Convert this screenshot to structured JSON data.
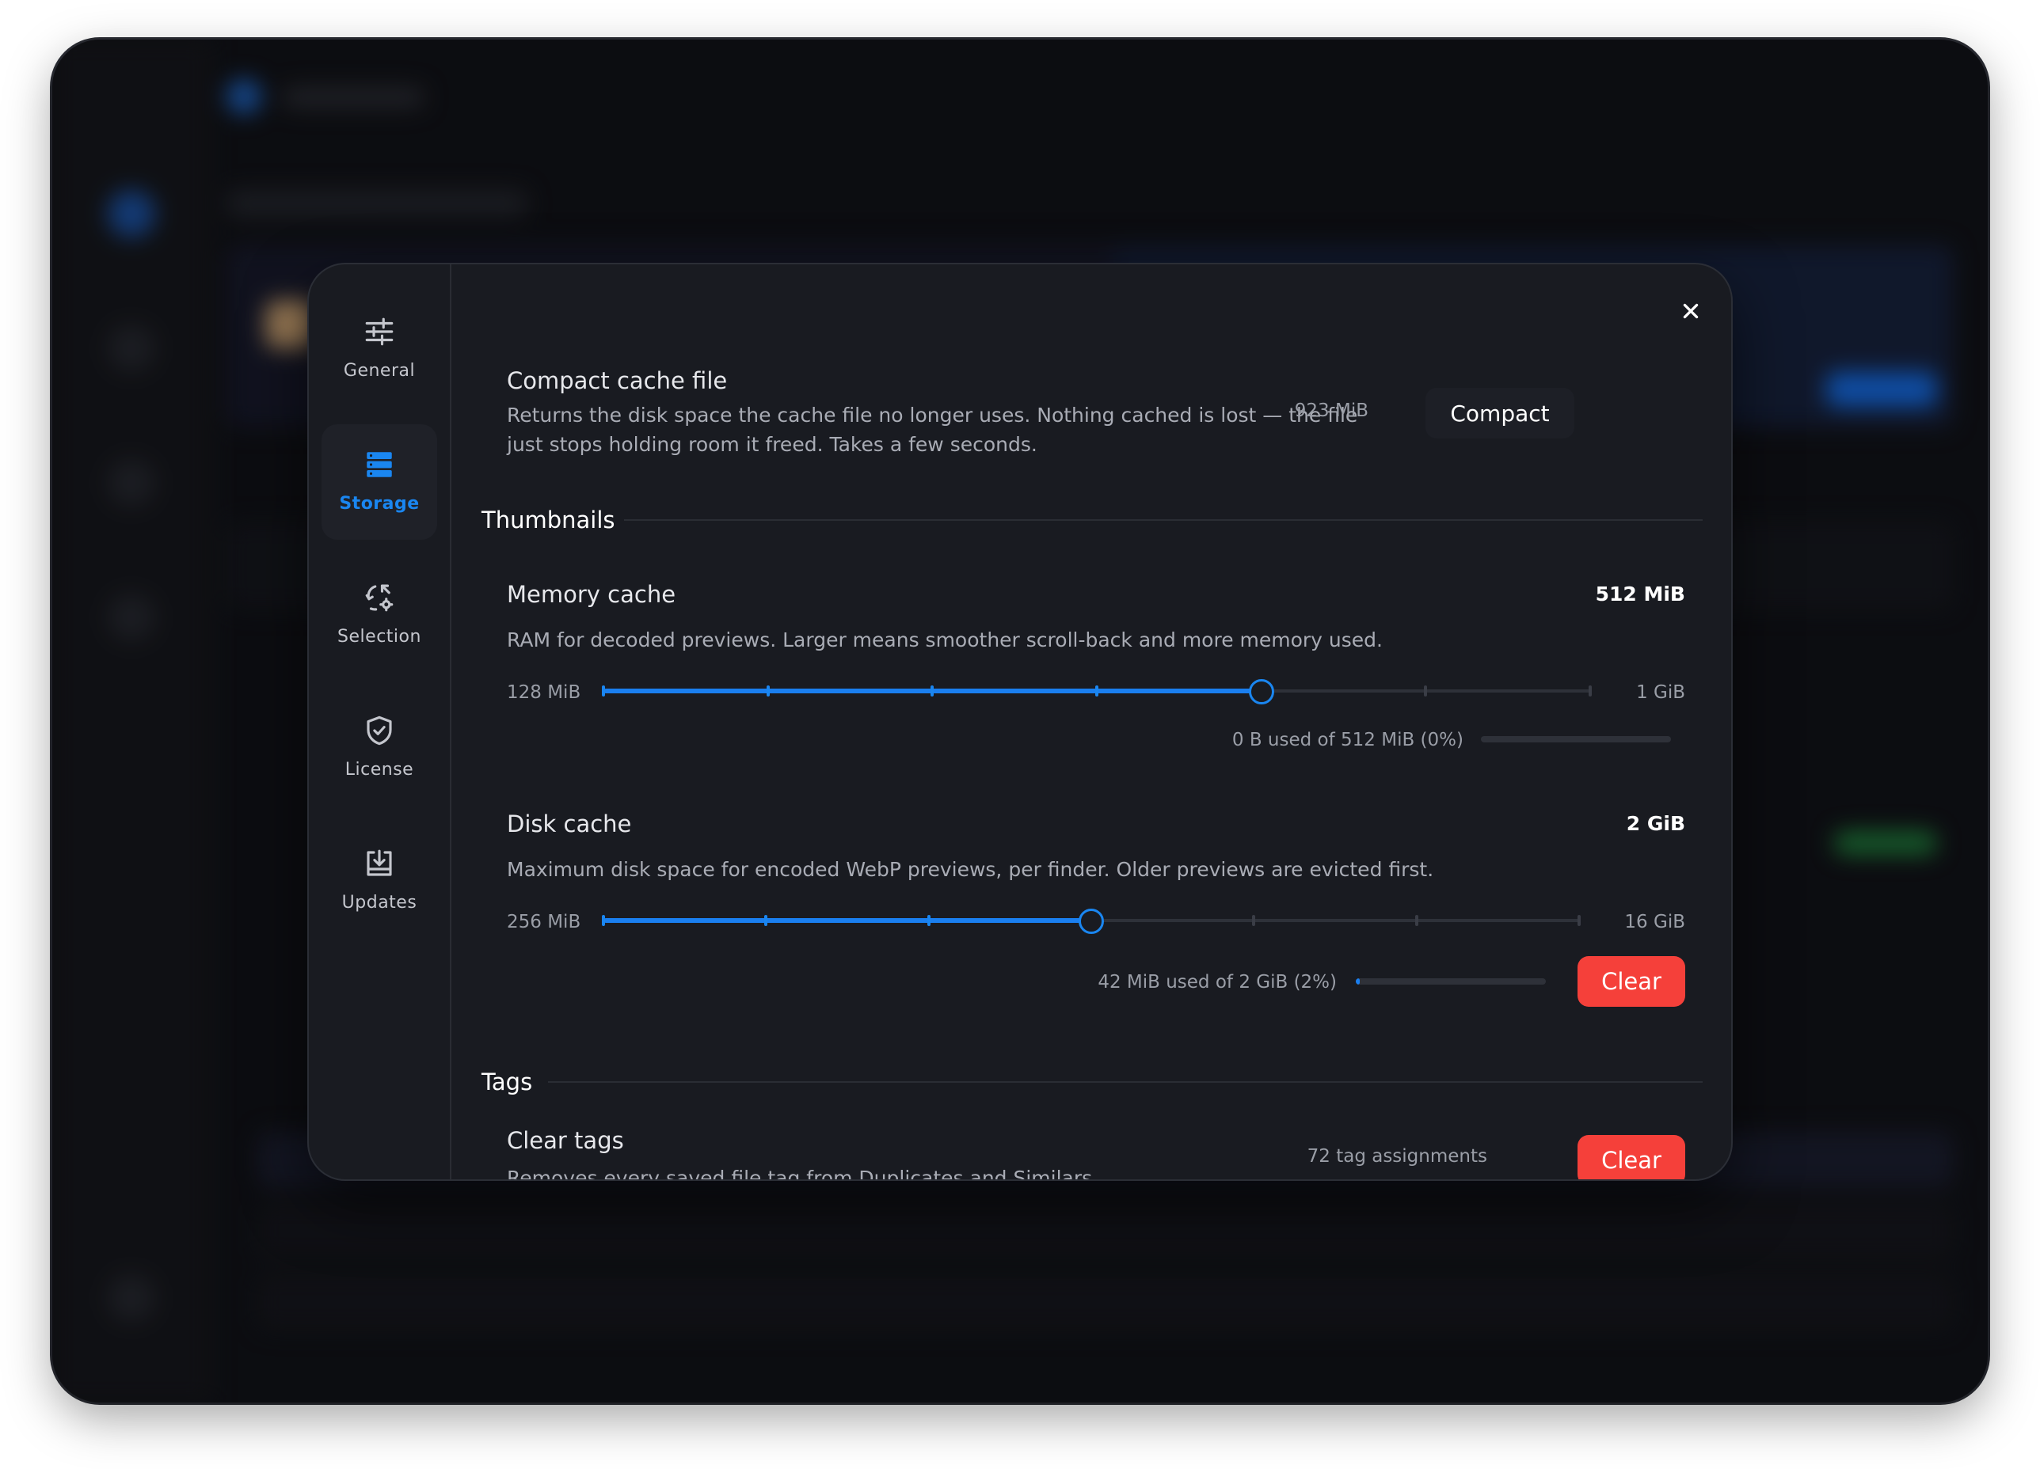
{
  "nav": {
    "items": [
      {
        "id": "general",
        "label": "General",
        "icon": "sliders-icon"
      },
      {
        "id": "storage",
        "label": "Storage",
        "icon": "storage-icon",
        "active": true
      },
      {
        "id": "selection",
        "label": "Selection",
        "icon": "selection-icon"
      },
      {
        "id": "license",
        "label": "License",
        "icon": "shield-icon"
      },
      {
        "id": "updates",
        "label": "Updates",
        "icon": "download-box-icon"
      }
    ]
  },
  "compact": {
    "title": "Compact cache file",
    "description_line1": "Returns the disk space the cache file no longer uses. Nothing cached is lost — the file",
    "description_line2": "just stops holding room it freed. Takes a few seconds.",
    "size": "923 MiB",
    "button": "Compact"
  },
  "thumbnails": {
    "section_title": "Thumbnails",
    "memory": {
      "title": "Memory cache",
      "value": "512 MiB",
      "description": "RAM for decoded previews. Larger means smoother scroll-back and more memory used.",
      "min_label": "128 MiB",
      "max_label": "1 GiB",
      "steps": 7,
      "position": 4,
      "usage_text": "0 B used of 512 MiB (0%)",
      "usage_fraction": 0.0
    },
    "disk": {
      "title": "Disk cache",
      "value": "2 GiB",
      "description": "Maximum disk space for encoded WebP previews, per finder. Older previews are evicted first.",
      "min_label": "256 MiB",
      "max_label": "16 GiB",
      "steps": 7,
      "position": 3,
      "usage_text": "42 MiB used of 2 GiB (2%)",
      "usage_fraction": 0.02,
      "button": "Clear"
    }
  },
  "tags": {
    "section_title": "Tags",
    "title": "Clear tags",
    "description": "Removes every saved file tag from Duplicates and Similars.",
    "count": "72 tag assignments",
    "button": "Clear"
  },
  "colors": {
    "accent": "#1a86f0",
    "danger": "#f5403a",
    "modal_bg": "#191b21"
  }
}
